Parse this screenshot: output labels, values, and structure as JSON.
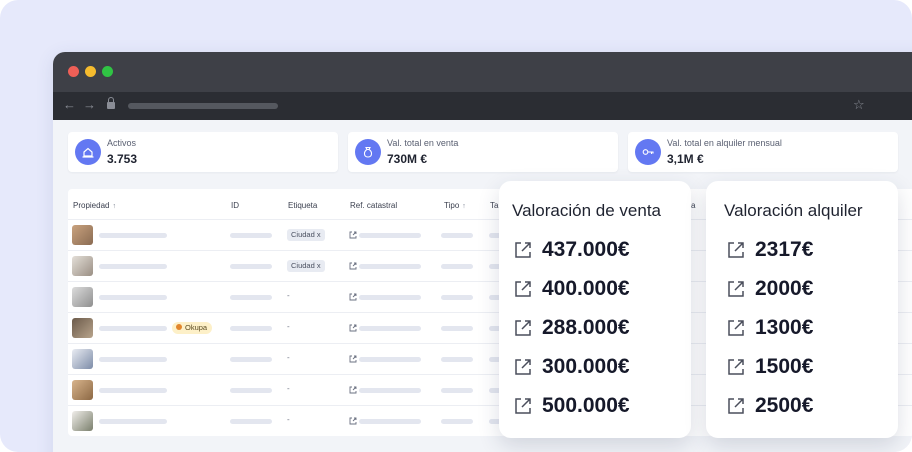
{
  "stats": [
    {
      "label": "Activos",
      "value": "3.753",
      "icon": "house-hand-icon"
    },
    {
      "label": "Val. total en venta",
      "value": "730M €",
      "icon": "money-bag-icon"
    },
    {
      "label": "Val. total en alquiler mensual",
      "value": "3,1M €",
      "icon": "key-icon"
    }
  ],
  "table": {
    "headers": {
      "propiedad": "Propiedad",
      "id": "ID",
      "etiqueta": "Etiqueta",
      "ref_catastral": "Ref. catastral",
      "tipo": "Tipo",
      "ta": "Ta",
      "a": "a"
    },
    "rows": [
      {
        "etiqueta": "Ciudad x",
        "badge": ""
      },
      {
        "etiqueta": "Ciudad x",
        "badge": ""
      },
      {
        "etiqueta": "-",
        "badge": ""
      },
      {
        "etiqueta": "-",
        "badge": "Okupa"
      },
      {
        "etiqueta": "-",
        "badge": ""
      },
      {
        "etiqueta": "-",
        "badge": ""
      },
      {
        "etiqueta": "-",
        "badge": ""
      }
    ]
  },
  "valoracion_venta": {
    "title": "Valoración de venta",
    "values": [
      "437.000€",
      "400.000€",
      "288.000€",
      "300.000€",
      "500.000€"
    ]
  },
  "valoracion_alquiler": {
    "title": "Valoración alquiler",
    "values": [
      "2317€",
      "2000€",
      "1300€",
      "1500€",
      "2500€"
    ]
  },
  "colors": {
    "accent": "#6378f2",
    "background": "#e6e9fb",
    "okupa_badge": "#fdf0c8"
  }
}
